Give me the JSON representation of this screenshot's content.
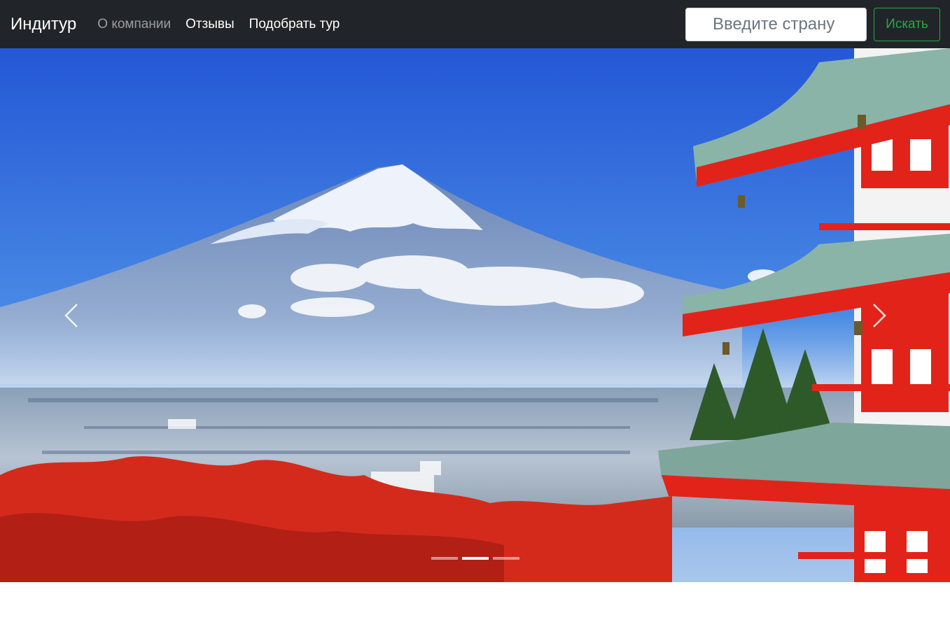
{
  "navbar": {
    "brand": "Индитур",
    "links": [
      {
        "label": "О компании",
        "active": true
      },
      {
        "label": "Отзывы",
        "active": false
      },
      {
        "label": "Подобрать тур",
        "active": false
      }
    ],
    "search": {
      "placeholder": "Введите страну",
      "value": "",
      "button_label": "Искать"
    }
  },
  "carousel": {
    "slide_count": 3,
    "active_index": 1,
    "prev_icon": "chevron-left-icon",
    "next_icon": "chevron-right-icon"
  },
  "colors": {
    "navbar_bg": "#212529",
    "success": "#28a745",
    "sky": "#2f6fd8",
    "pagoda_red": "#e2231a",
    "foliage_red": "#d42a1c"
  }
}
